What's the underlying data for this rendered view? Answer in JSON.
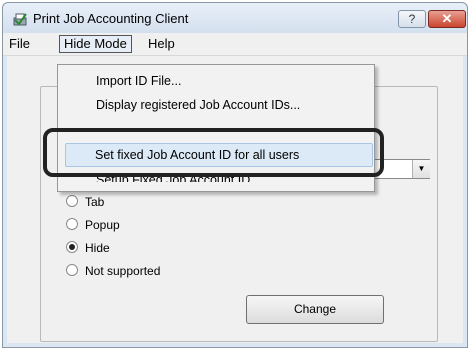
{
  "window": {
    "title": "Print Job Accounting Client",
    "help_btn": "?",
    "close_btn": "✕",
    "app_icon": "printer-check-icon"
  },
  "menubar": {
    "items": [
      {
        "label": "File"
      },
      {
        "label": "Hide Mode"
      },
      {
        "label": "Help"
      }
    ]
  },
  "dropdown": {
    "items": [
      {
        "label": "Import ID File..."
      },
      {
        "label": "Display registered Job Account IDs..."
      },
      {
        "label": "Set fixed Job Account ID for all users"
      },
      {
        "label": "Setup Fixed Job Account ID..."
      }
    ]
  },
  "mode_options": [
    {
      "label": "Tab",
      "checked": false
    },
    {
      "label": "Popup",
      "checked": false
    },
    {
      "label": "Hide",
      "checked": true
    },
    {
      "label": "Not supported",
      "checked": false
    }
  ],
  "change_button": "Change",
  "combo_arrow": "▼",
  "colors": {
    "highlight": "#dce9f6",
    "callout_border": "#222222",
    "close_red": "#c9452f"
  }
}
